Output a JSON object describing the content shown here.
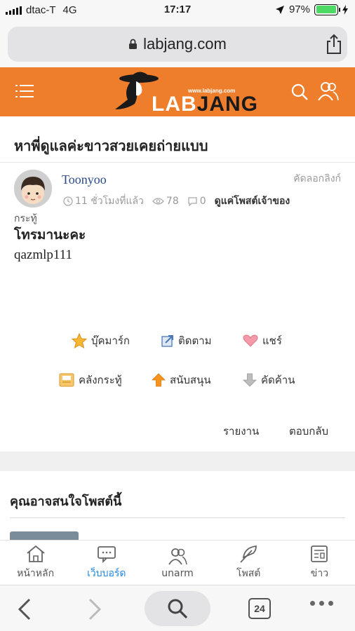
{
  "status": {
    "carrier": "dtac-T",
    "network": "4G",
    "time": "17:17",
    "battery_level": "97%",
    "battery_fraction": 0.97
  },
  "browser": {
    "url": "labjang.com",
    "tab_count": "24"
  },
  "site": {
    "logo_url": "www.labjang.com",
    "logo_word_1": "LAB",
    "logo_word_2": "JANG",
    "accent": "#ef7e2c"
  },
  "post": {
    "title": "หาพี่ดูแลค่ะขาวสวยเคยถ่ายแบบ",
    "author": "Toonyoo",
    "copy_link": "คัดลอกลิงก์",
    "time_ago": "11 ชั่วโมงที่แล้ว",
    "views": "78",
    "comments": "0",
    "owner_posts": "ดูแค่โพสต์เจ้าของ",
    "category": "กระทู้",
    "body_heading": "โทรมานะคะ",
    "body_text": "qazmlp111"
  },
  "actions": {
    "bookmark": "บุ๊คมาร์ก",
    "follow": "ติดตาม",
    "share": "แชร์",
    "archive": "คลังกระทู้",
    "support": "สนับสนุน",
    "oppose": "คัดค้าน",
    "report": "รายงาน",
    "reply": "ตอบกลับ"
  },
  "related": {
    "title": "คุณอาจสนใจโพสต์นี้"
  },
  "nav": {
    "home": "หน้าหลัก",
    "board": "เว็บบอร์ด",
    "unarm": "unarm",
    "post": "โพสต์",
    "news": "ข่าว",
    "active_color": "#1e88e5"
  }
}
